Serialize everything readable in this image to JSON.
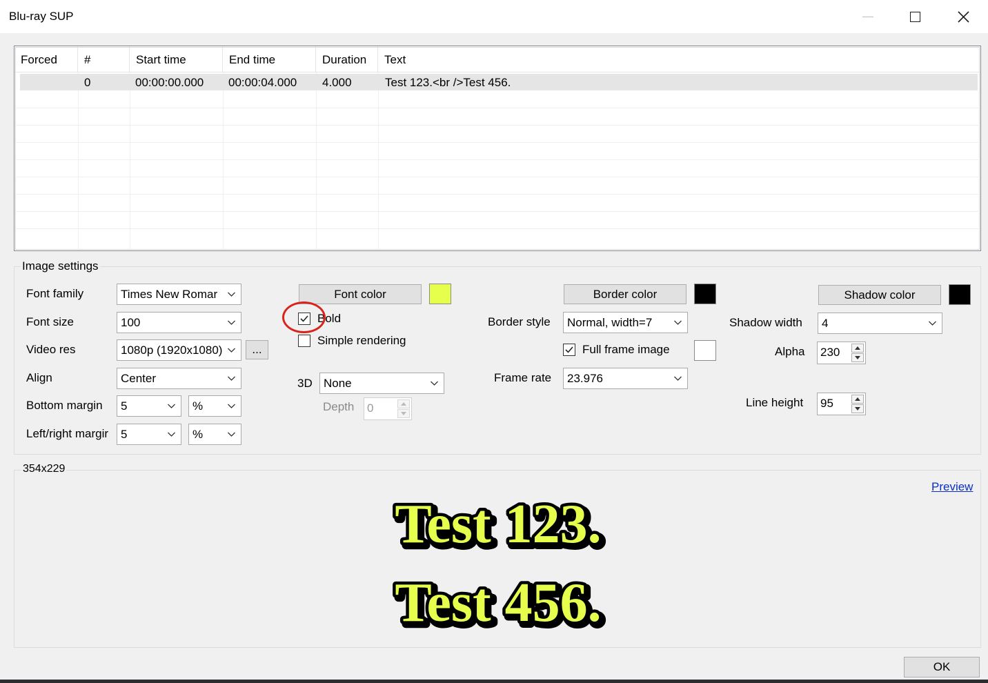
{
  "window": {
    "title": "Blu-ray SUP",
    "minimize_icon": "minimize-icon",
    "maximize_icon": "maximize-icon",
    "close_icon": "close-icon"
  },
  "grid": {
    "columns": [
      "Forced",
      "#",
      "Start time",
      "End time",
      "Duration",
      "Text"
    ],
    "rows": [
      {
        "forced": "",
        "number": "0",
        "start": "00:00:00.000",
        "end": "00:00:04.000",
        "duration": "4.000",
        "text": "Test 123.<br />Test 456."
      }
    ]
  },
  "image_settings": {
    "group_label": "Image settings",
    "font_family_label": "Font family",
    "font_family_value": "Times New Romar",
    "font_size_label": "Font size",
    "font_size_value": "100",
    "video_res_label": "Video res",
    "video_res_value": "1080p (1920x1080)",
    "video_res_more": "...",
    "align_label": "Align",
    "align_value": "Center",
    "bottom_margin_label": "Bottom margin",
    "bottom_margin_value": "5",
    "bottom_margin_unit": "%",
    "lr_margin_label": "Left/right margir",
    "lr_margin_value": "5",
    "lr_margin_unit": "%",
    "font_color_button": "Font color",
    "font_color": "#e6ff4d",
    "bold_label": "Bold",
    "bold_checked": true,
    "simple_rendering_label": "Simple rendering",
    "simple_rendering_checked": false,
    "three_d_label": "3D",
    "three_d_value": "None",
    "depth_label": "Depth",
    "depth_value": "0",
    "border_color_button": "Border color",
    "border_color": "#000000",
    "border_style_label": "Border style",
    "border_style_value": "Normal, width=7",
    "full_frame_label": "Full frame image",
    "full_frame_checked": true,
    "full_frame_color": "#ffffff",
    "frame_rate_label": "Frame rate",
    "frame_rate_value": "23.976",
    "shadow_color_button": "Shadow color",
    "shadow_color": "#000000",
    "shadow_width_label": "Shadow width",
    "shadow_width_value": "4",
    "alpha_label": "Alpha",
    "alpha_value": "230",
    "line_height_label": "Line height",
    "line_height_value": "95"
  },
  "preview": {
    "size_label": "354x229",
    "link": "Preview",
    "line1": "Test 123.",
    "line2": "Test 456."
  },
  "footer": {
    "ok_label": "OK"
  }
}
